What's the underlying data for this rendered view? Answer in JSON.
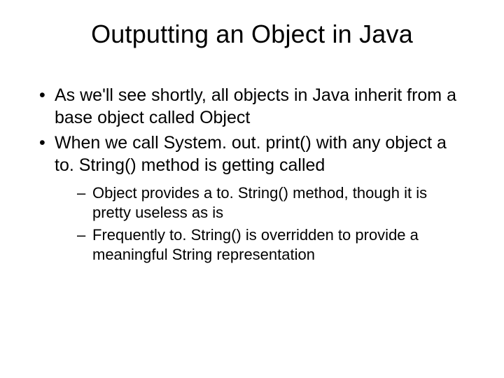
{
  "title": "Outputting an Object in Java",
  "bullets": [
    {
      "text": "As we'll see shortly, all objects in Java inherit from a base object called Object"
    },
    {
      "text": "When we call System. out. print() with any object a to. String() method is getting called",
      "subs": [
        {
          "text": "Object provides a to. String() method, though it is pretty useless as is"
        },
        {
          "text": "Frequently to. String() is overridden to provide a meaningful String representation"
        }
      ]
    }
  ]
}
